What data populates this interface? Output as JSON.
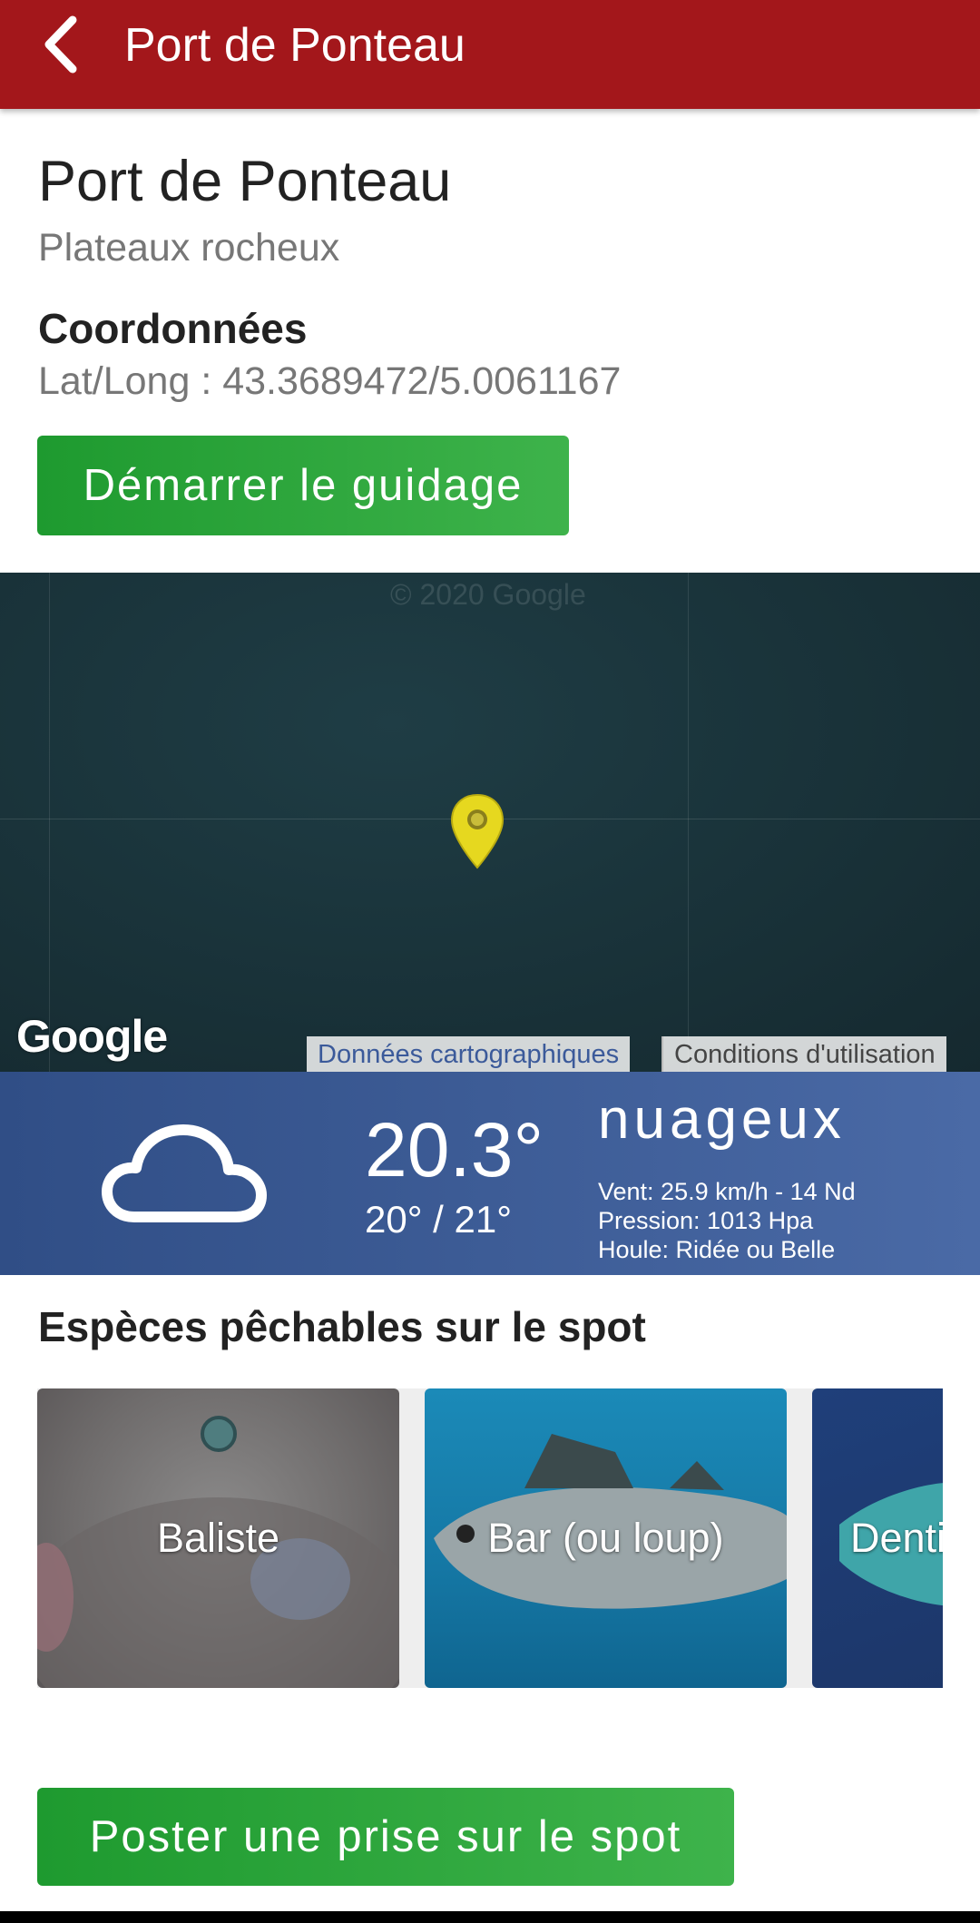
{
  "appbar": {
    "title": "Port de Ponteau",
    "back_icon": "chevron-left-icon"
  },
  "spot": {
    "name": "Port de Ponteau",
    "type": "Plateaux rocheux",
    "coords_label": "Coordonnées",
    "coords_value": "Lat/Long : 43.3689472/5.0061167"
  },
  "buttons": {
    "guide": "Démarrer le guidage",
    "post": "Poster une prise sur le spot"
  },
  "map": {
    "copyright": "© 2020 Google",
    "logo": "Google",
    "data_link": "Données cartographiques",
    "terms_link": "Conditions d'utilisation",
    "pin_color": "#e6d81f"
  },
  "weather": {
    "icon": "cloud-icon",
    "temp": "20.3°",
    "minmax": "20° / 21°",
    "condition": "nuageux",
    "wind": "Vent: 25.9 km/h - 14 Nd",
    "pressure": "Pression: 1013 Hpa",
    "swell": "Houle: Ridée ou Belle"
  },
  "species": {
    "title": "Espèces pêchables sur le spot",
    "items": [
      {
        "label": "Baliste"
      },
      {
        "label": "Bar (ou loup)"
      },
      {
        "label": "Denti"
      }
    ]
  },
  "colors": {
    "appbar": "#a3171b",
    "button": "#2aa63b",
    "weather": "#3b5b95"
  }
}
